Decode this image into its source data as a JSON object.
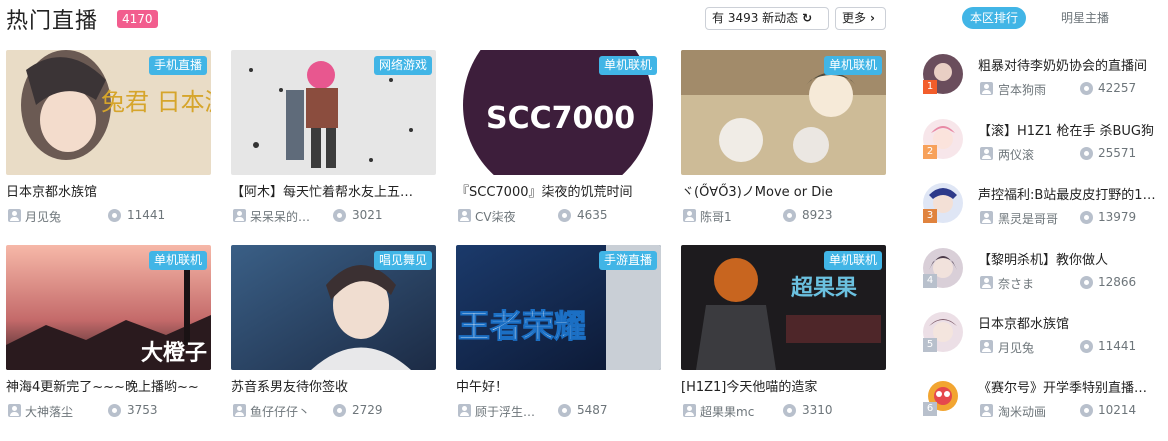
{
  "header": {
    "title": "热门直播",
    "count": "4170",
    "refresh_label": "有 3493 新动态",
    "more_label": "更多"
  },
  "colors": {
    "accent": "#41b5e6",
    "badge": "#f25d8e",
    "rank_top": "#f25d2b",
    "rank_other": "#b8c0cc"
  },
  "cards": [
    {
      "tag": "手机直播",
      "title": "日本京都水族馆",
      "user": "月见兔",
      "views": "11441",
      "overlay": "兔君 日本游"
    },
    {
      "tag": "网络游戏",
      "title": "【阿木】每天忙着帮水友上五…",
      "user": "呆呆呆的…",
      "views": "3021",
      "overlay": ""
    },
    {
      "tag": "单机联机",
      "title": "『SCC7000』柒夜的饥荒时间",
      "user": "CV柒夜",
      "views": "4635",
      "overlay": "SCC7000"
    },
    {
      "tag": "单机联机",
      "title": "ヾ(Ő∀Ő3)ノMove or Die",
      "user": "陈哥1",
      "views": "8923",
      "overlay": ""
    },
    {
      "tag": "单机联机",
      "title": "神海4更新完了~~~晚上播哟~~",
      "user": "大神落尘",
      "views": "3753",
      "overlay": "大橙子"
    },
    {
      "tag": "唱见舞见",
      "title": "苏音系男友待你签收",
      "user": "鱼仔仔仔丶",
      "views": "2729",
      "overlay": ""
    },
    {
      "tag": "手游直播",
      "title": "中午好！",
      "user": "顾于浮生…",
      "views": "5487",
      "overlay": "王者荣耀"
    },
    {
      "tag": "单机联机",
      "title": "[H1Z1]今天他喵的造家",
      "user": "超果果mc",
      "views": "3310",
      "overlay": "超果果"
    }
  ],
  "sidebar": {
    "tabs": [
      "本区排行",
      "明星主播"
    ],
    "ranks": [
      {
        "num": "1",
        "title": "粗暴对待李奶奶协会的直播间",
        "user": "宫本狗雨",
        "views": "42257"
      },
      {
        "num": "2",
        "title": "【滚】H1Z1 枪在手 杀BUG狗",
        "user": "两仪滚",
        "views": "25571"
      },
      {
        "num": "3",
        "title": "声控福利:B站最皮皮打野的1…",
        "user": "黑灵是哥哥",
        "views": "13979"
      },
      {
        "num": "4",
        "title": "【黎明杀机】教你做人",
        "user": "奈さま",
        "views": "12866"
      },
      {
        "num": "5",
        "title": "日本京都水族馆",
        "user": "月见兔",
        "views": "11441"
      },
      {
        "num": "6",
        "title": "《赛尔号》开学季特别直播…",
        "user": "淘米动画",
        "views": "10214"
      }
    ]
  }
}
